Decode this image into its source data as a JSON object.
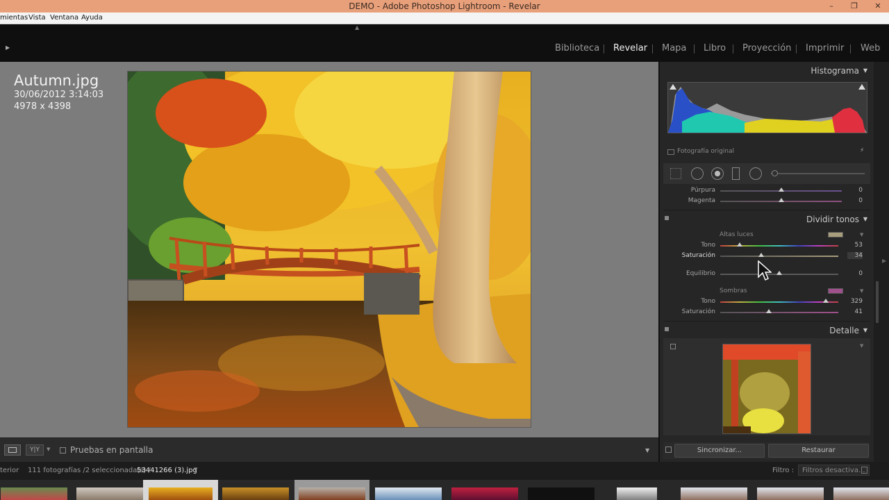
{
  "window": {
    "title": "DEMO - Adobe Photoshop Lightroom - Revelar"
  },
  "menu": [
    "mientas",
    "Vista",
    "Ventana",
    "Ayuda"
  ],
  "modules": [
    {
      "label": "Biblioteca",
      "active": false
    },
    {
      "label": "Revelar",
      "active": true
    },
    {
      "label": "Mapa",
      "active": false
    },
    {
      "label": "Libro",
      "active": false
    },
    {
      "label": "Proyección",
      "active": false
    },
    {
      "label": "Imprimir",
      "active": false
    },
    {
      "label": "Web",
      "active": false
    }
  ],
  "photo_info": {
    "filename": "Autumn.jpg",
    "datetime": "30/06/2012 3:14:03",
    "dimensions": "4978 x 4398"
  },
  "histogram": {
    "title": "Histograma",
    "original_label": "Fotografía original"
  },
  "hsl_rows": [
    {
      "label": "Púrpura",
      "value": "0",
      "position": 0.5
    },
    {
      "label": "Magenta",
      "value": "0",
      "position": 0.5
    }
  ],
  "split_toning": {
    "title": "Dividir tonos",
    "highlights_label": "Altas luces",
    "highlights_color": "#a89e7c",
    "highlight_hue": {
      "label": "Tono",
      "value": "53"
    },
    "highlight_saturation": {
      "label": "Saturación",
      "value": "34"
    },
    "balance": {
      "label": "Equilibrio",
      "value": "0"
    },
    "shadows_label": "Sombras",
    "shadows_color": "#a0508c",
    "shadow_hue": {
      "label": "Tono",
      "value": "329"
    },
    "shadow_saturation": {
      "label": "Saturación",
      "value": "41"
    }
  },
  "detail": {
    "title": "Detalle"
  },
  "buttons": {
    "sync": "Sincronizar...",
    "reset": "Restaurar"
  },
  "toolbar": {
    "soft_proof": "Pruebas en pantalla"
  },
  "filmstrip": {
    "prev_fragment": "terior",
    "info_prefix": "111 fotografías /2 seleccionada(s) /",
    "current_file": "53441266 (3).jpg",
    "filter_label": "Filtro :",
    "filter_value": "Filtros desactiva..."
  }
}
